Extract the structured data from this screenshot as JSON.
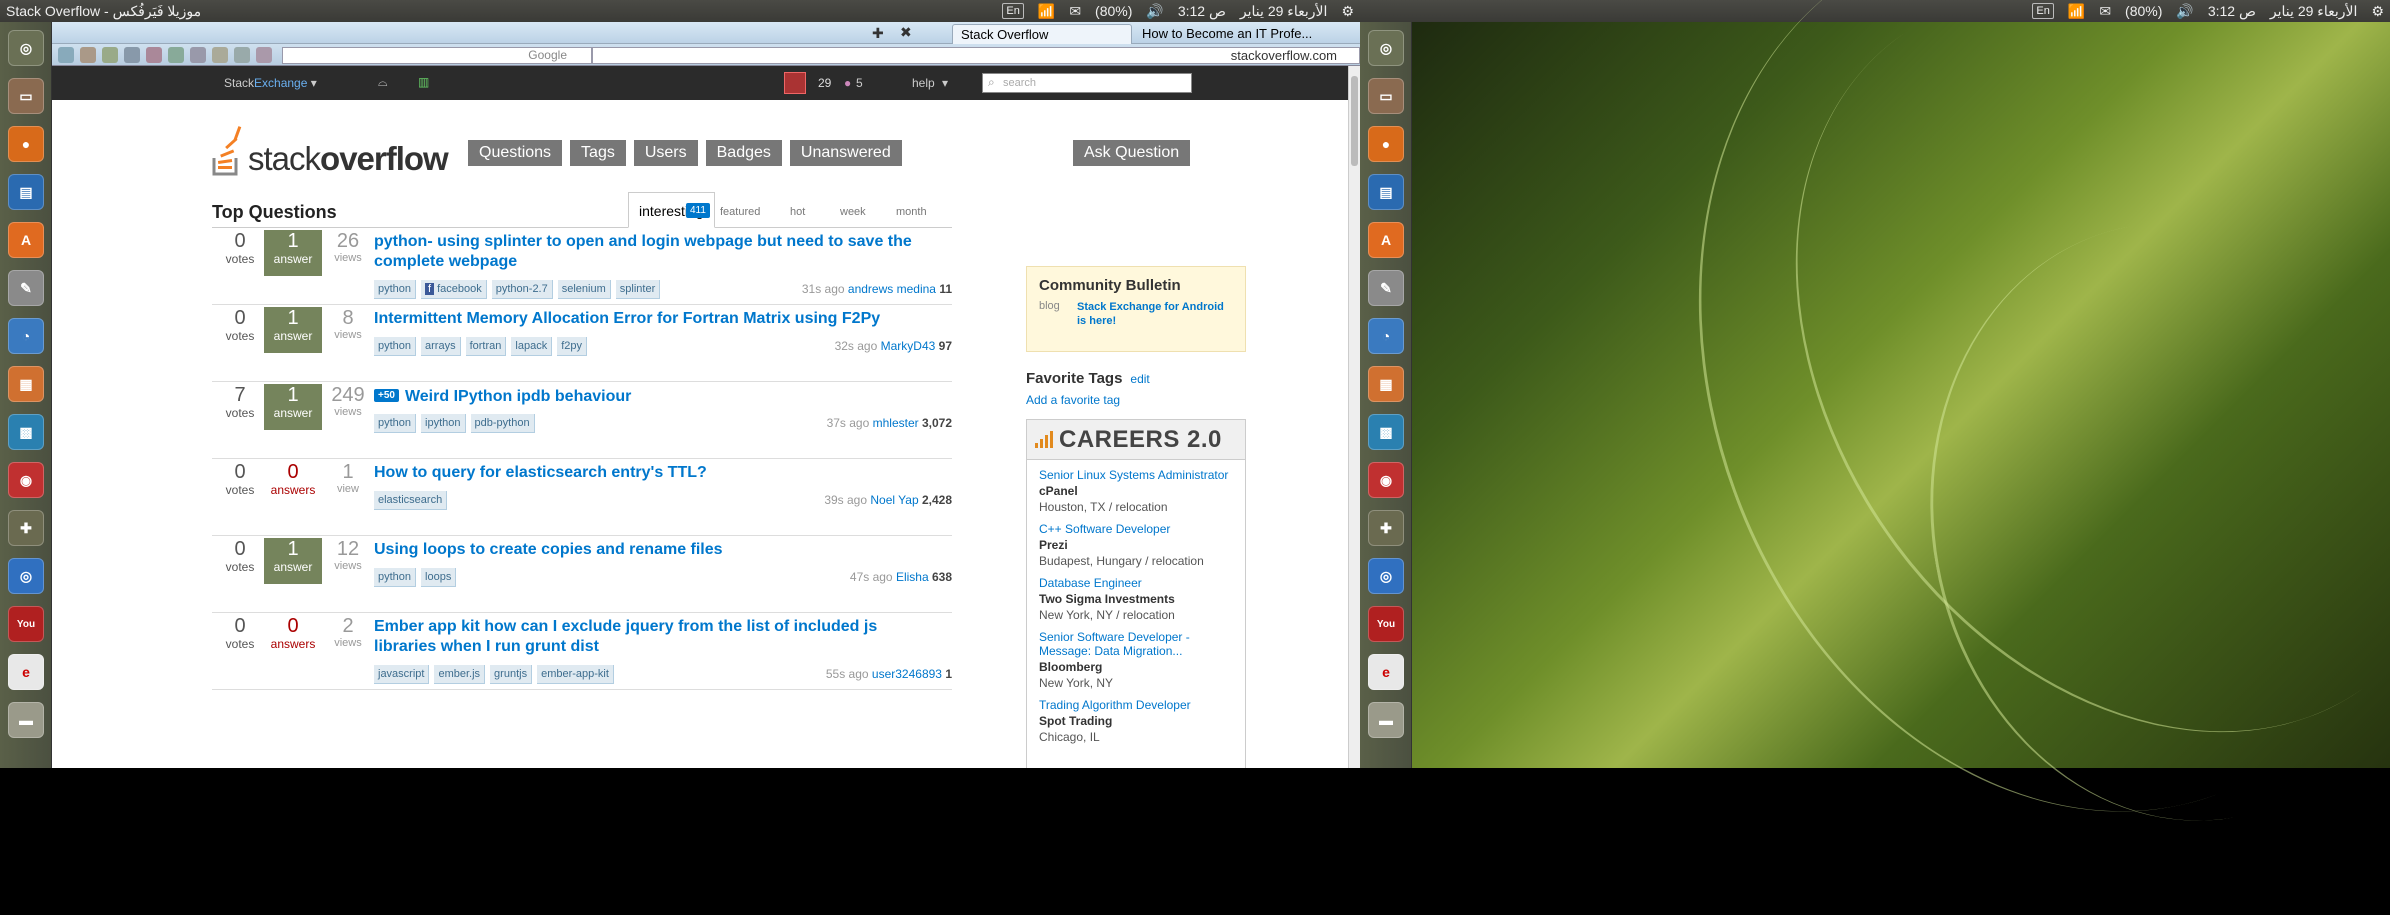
{
  "panel_left": {
    "title": "Stack Overflow - موزيلا فَيَرفُكس",
    "lang": "En",
    "battery": "(80%)",
    "time": "3:12 ص",
    "date": "الأربعاء 29 يناير"
  },
  "panel_right": {
    "lang": "En",
    "battery": "(80%)",
    "time": "3:12 ص",
    "date": "الأربعاء 29 يناير"
  },
  "browser": {
    "tabs": [
      "Stack Overflow",
      "How to Become an IT Profe..."
    ],
    "search_placeholder": "Google",
    "url": "stackoverflow.com"
  },
  "se_bar": {
    "brand_a": "Stack",
    "brand_b": "Exchange",
    "rep": "29",
    "badges": "5",
    "help": "help",
    "search_placeholder": "search"
  },
  "header": {
    "logo_a": "stack",
    "logo_b": "overflow",
    "nav": [
      "Questions",
      "Tags",
      "Users",
      "Badges",
      "Unanswered"
    ],
    "ask": "Ask Question"
  },
  "top_questions": {
    "title": "Top Questions",
    "tabs": {
      "interesting": "interesting",
      "featured_count": "411",
      "featured": "featured",
      "hot": "hot",
      "week": "week",
      "month": "month"
    },
    "questions": [
      {
        "votes": "0",
        "votes_l": "votes",
        "answers": "1",
        "answers_l": "answer",
        "views": "26",
        "views_l": "views",
        "title": "python- using splinter to open and login webpage but need to save the complete webpage",
        "tags": [
          "python",
          "facebook",
          "python-2.7",
          "selenium",
          "splinter"
        ],
        "time": "31s ago",
        "user": "andrews medina",
        "rep": "11"
      },
      {
        "votes": "0",
        "votes_l": "votes",
        "answers": "1",
        "answers_l": "answer",
        "views": "8",
        "views_l": "views",
        "title": "Intermittent Memory Allocation Error for Fortran Matrix using F2Py",
        "tags": [
          "python",
          "arrays",
          "fortran",
          "lapack",
          "f2py"
        ],
        "time": "32s ago",
        "user": "MarkyD43",
        "rep": "97"
      },
      {
        "votes": "7",
        "votes_l": "votes",
        "answers": "1",
        "answers_l": "answer",
        "views": "249",
        "views_l": "views",
        "bonus": "+50",
        "title": "Weird IPython ipdb behaviour",
        "tags": [
          "python",
          "ipython",
          "pdb-python"
        ],
        "time": "37s ago",
        "user": "mhlester",
        "rep": "3,072"
      },
      {
        "votes": "0",
        "votes_l": "votes",
        "answers": "0",
        "answers_l": "answers",
        "views": "1",
        "views_l": "view",
        "title": "How to query for elasticsearch entry's TTL?",
        "tags": [
          "elasticsearch"
        ],
        "time": "39s ago",
        "user": "Noel Yap",
        "rep": "2,428"
      },
      {
        "votes": "0",
        "votes_l": "votes",
        "answers": "1",
        "answers_l": "answer",
        "views": "12",
        "views_l": "views",
        "title": "Using loops to create copies and rename files",
        "tags": [
          "python",
          "loops"
        ],
        "time": "47s ago",
        "user": "Elisha",
        "rep": "638"
      },
      {
        "votes": "0",
        "votes_l": "votes",
        "answers": "0",
        "answers_l": "answers",
        "views": "2",
        "views_l": "views",
        "title": "Ember app kit how can I exclude jquery from the list of included js libraries when I run grunt dist",
        "tags": [
          "javascript",
          "ember.js",
          "gruntjs",
          "ember-app-kit"
        ],
        "time": "55s ago",
        "user": "user3246893",
        "rep": "1"
      }
    ]
  },
  "sidebar": {
    "bulletin_title": "Community Bulletin",
    "bulletin_kind": "blog",
    "bulletin_link": "Stack Exchange for Android is here!",
    "fav_title": "Favorite Tags",
    "fav_edit": "edit",
    "fav_add": "Add a favorite tag",
    "careers_title": "CAREERS 2.0",
    "jobs": [
      {
        "title": "Senior Linux Systems Administrator",
        "company": "cPanel",
        "loc": "Houston, TX / relocation"
      },
      {
        "title": "C++ Software Developer",
        "company": "Prezi",
        "loc": "Budapest, Hungary / relocation"
      },
      {
        "title": "Database Engineer",
        "company": "Two Sigma Investments",
        "loc": "New York, NY / relocation"
      },
      {
        "title": "Senior Software Developer - Message: Data Migration...",
        "company": "Bloomberg",
        "loc": "New York, NY"
      },
      {
        "title": "Trading Algorithm Developer",
        "company": "Spot Trading",
        "loc": "Chicago, IL"
      }
    ]
  }
}
